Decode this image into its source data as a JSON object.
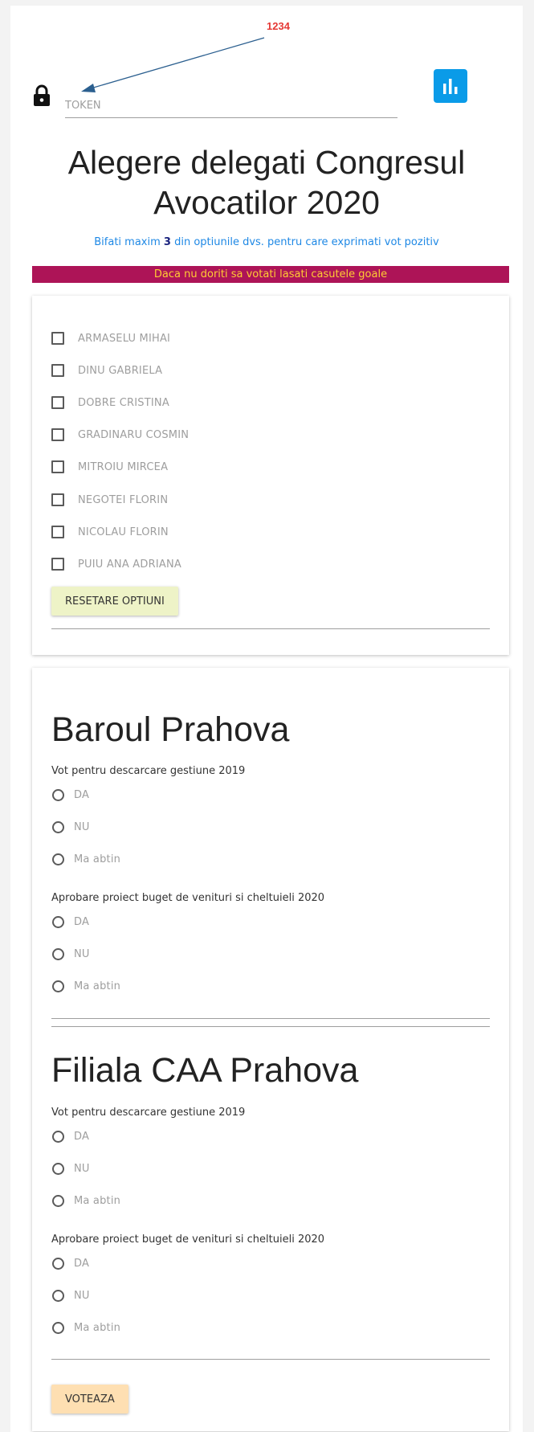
{
  "annotation": {
    "label": "1234"
  },
  "token": {
    "placeholder": "TOKEN",
    "value": ""
  },
  "icons": {
    "lock": "lock-icon",
    "stats": "bar-chart-icon"
  },
  "colors": {
    "accent_blue": "#0a9be8",
    "warning_bg": "#ad1457",
    "warning_text": "#ffcc33",
    "reset_btn": "#eef3c7",
    "vote_btn": "#fedfb2"
  },
  "title": "Alegere delegati Congresul Avocatilor 2020",
  "subtitle": {
    "before": "Bifati maxim ",
    "max": "3",
    "after": " din optiunile dvs. pentru care exprimati vot pozitiv"
  },
  "warning": "Daca nu doriti sa votati lasati casutele goale",
  "candidates": [
    {
      "label": "ARMASELU MIHAI",
      "checked": false
    },
    {
      "label": "DINU GABRIELA",
      "checked": false
    },
    {
      "label": "DOBRE CRISTINA",
      "checked": false
    },
    {
      "label": "GRADINARU COSMIN",
      "checked": false
    },
    {
      "label": "MITROIU MIRCEA",
      "checked": false
    },
    {
      "label": "NEGOTEI FLORIN",
      "checked": false
    },
    {
      "label": "NICOLAU FLORIN",
      "checked": false
    },
    {
      "label": "PUIU ANA ADRIANA",
      "checked": false
    }
  ],
  "reset_button": "RESETARE OPTIUNI",
  "sections": [
    {
      "title": "Baroul Prahova",
      "questions": [
        {
          "text": "Vot pentru descarcare gestiune 2019",
          "options": [
            "DA",
            "NU",
            "Ma abtin"
          ]
        },
        {
          "text": "Aprobare proiect buget de venituri si cheltuieli 2020",
          "options": [
            "DA",
            "NU",
            "Ma abtin"
          ]
        }
      ]
    },
    {
      "title": "Filiala CAA Prahova",
      "questions": [
        {
          "text": "Vot pentru descarcare gestiune 2019",
          "options": [
            "DA",
            "NU",
            "Ma abtin"
          ]
        },
        {
          "text": "Aprobare proiect buget de venituri si cheltuieli 2020",
          "options": [
            "DA",
            "NU",
            "Ma abtin"
          ]
        }
      ]
    }
  ],
  "vote_button": "VOTEAZA"
}
